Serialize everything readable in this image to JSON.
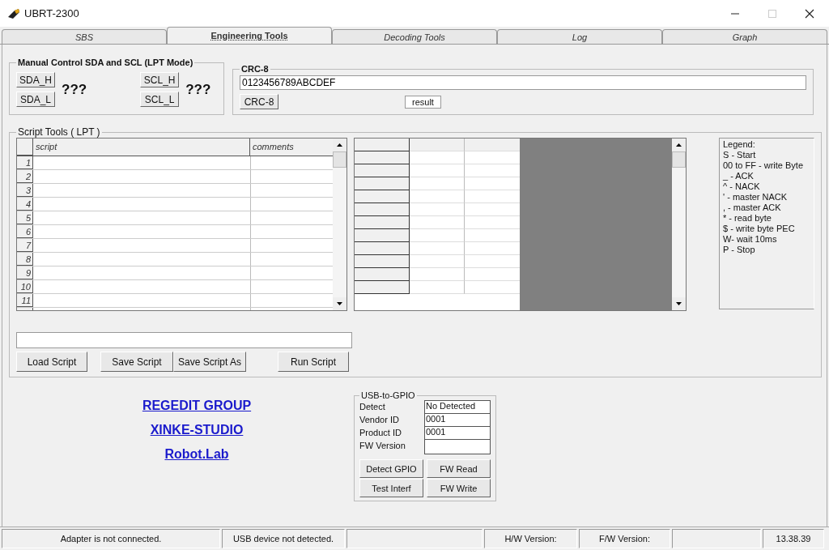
{
  "window": {
    "title": "UBRT-2300"
  },
  "tabs": [
    {
      "label": "SBS",
      "selected": false
    },
    {
      "label": "Engineering Tools",
      "selected": true
    },
    {
      "label": "Decoding Tools",
      "selected": false
    },
    {
      "label": "Log",
      "selected": false
    },
    {
      "label": "Graph",
      "selected": false
    }
  ],
  "manual_control": {
    "title": "Manual Control SDA and SCL  (LPT Mode)",
    "sda_buttons": [
      "SDA_H",
      "SDA_L"
    ],
    "sda_state": "???",
    "scl_buttons": [
      "SCL_H",
      "SCL_L"
    ],
    "scl_state": "???"
  },
  "crc": {
    "title": "CRC-8",
    "input": "0123456789ABCDEF",
    "button": "CRC-8",
    "result": "result"
  },
  "script_tools": {
    "title": "Script Tools ( LPT )",
    "columns": [
      "script",
      "comments"
    ],
    "row_numbers": [
      "1",
      "2",
      "3",
      "4",
      "5",
      "6",
      "7",
      "8",
      "9",
      "10",
      "11"
    ],
    "buttons": [
      "Load Script",
      "Save Script",
      "Save Script As",
      "Run Script"
    ],
    "legend": [
      "Legend:",
      "S - Start",
      "00 to FF - write Byte",
      "_ - ACK",
      "^ - NACK",
      "' -  master NACK",
      ", -  master ACK",
      "* - read byte",
      "$ - write byte PEC",
      "W- wait 10ms",
      "P - Stop"
    ]
  },
  "links": [
    "REGEDIT GROUP",
    "XINKE-STUDIO",
    "Robot.Lab"
  ],
  "usb_gpio": {
    "title": "USB-to-GPIO",
    "fields": [
      {
        "label": "Detect",
        "value": "No Detected"
      },
      {
        "label": "Vendor  ID",
        "value": "0001"
      },
      {
        "label": "Product ID",
        "value": "0001"
      },
      {
        "label": "FW Version"
      }
    ],
    "buttons": [
      "Detect GPIO",
      "FW Read",
      "Test Interf",
      "FW Write"
    ]
  },
  "status_bar": [
    {
      "kind": "text",
      "text": "Adapter is not connected."
    },
    {
      "kind": "text",
      "text": "USB device not detected."
    },
    {
      "kind": "blank"
    },
    {
      "kind": "text",
      "text": "H/W Version:"
    },
    {
      "kind": "text",
      "text": "F/W Version:"
    },
    {
      "kind": "blank"
    },
    {
      "kind": "text",
      "text": "13.38.39"
    }
  ]
}
